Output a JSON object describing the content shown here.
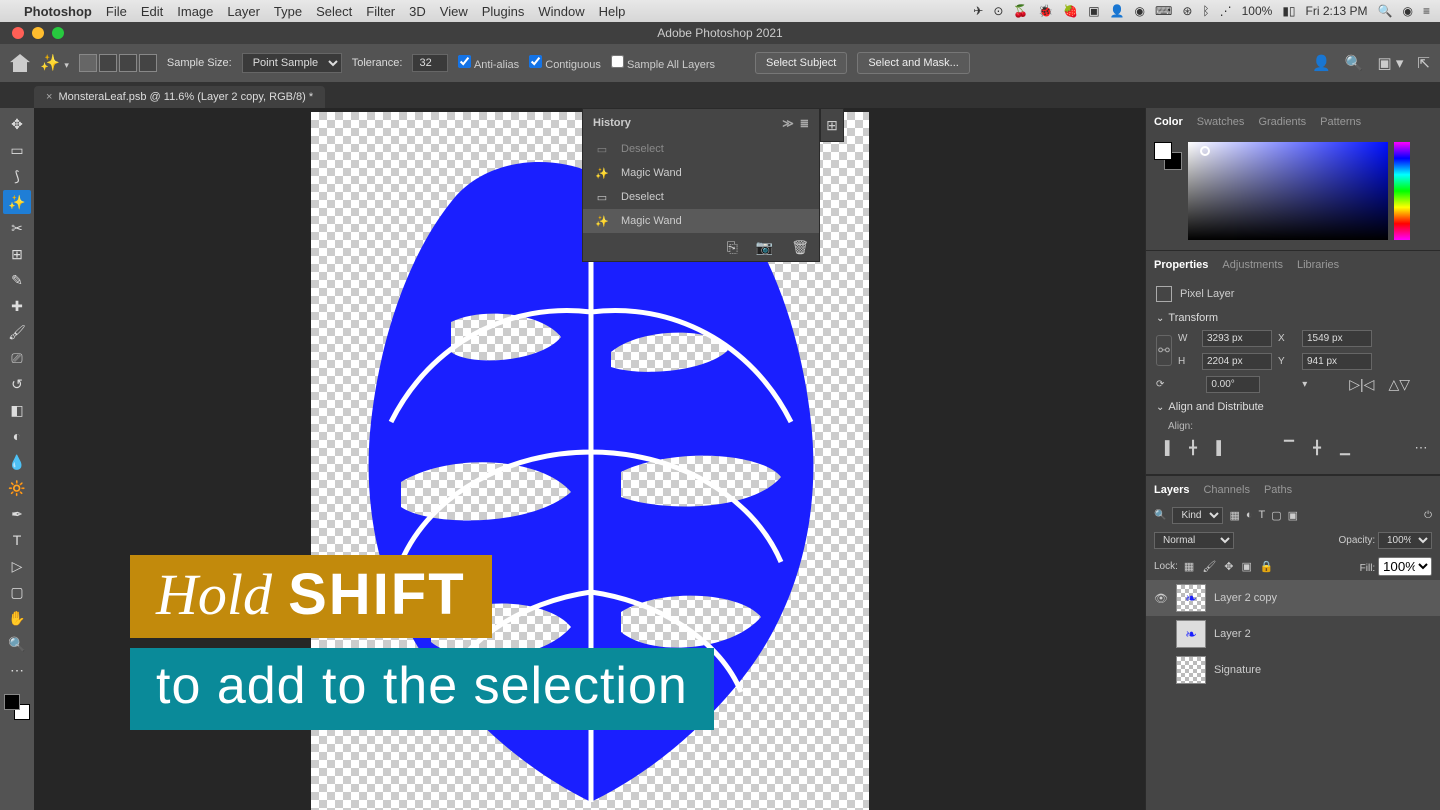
{
  "macbar": {
    "app": "Photoshop",
    "menus": [
      "File",
      "Edit",
      "Image",
      "Layer",
      "Type",
      "Select",
      "Filter",
      "3D",
      "View",
      "Plugins",
      "Window",
      "Help"
    ],
    "right_icons": [
      "✈",
      "⊙",
      "🍒",
      "🐻",
      "🍓",
      "📹",
      "👤",
      "◉",
      "⌨",
      "✱",
      "⧉",
      "✶",
      "⚡",
      "⇪",
      "100%",
      "🔋",
      "Fri 2:13 PM"
    ]
  },
  "titlebar": {
    "title": "Adobe Photoshop 2021"
  },
  "options": {
    "sample_label": "Sample Size:",
    "sample_value": "Point Sample",
    "tol_label": "Tolerance:",
    "tol_value": "32",
    "anti": "Anti-alias",
    "contig": "Contiguous",
    "sample_all": "Sample All Layers",
    "select_subject": "Select Subject",
    "select_mask": "Select and Mask..."
  },
  "doc_tab": "MonsteraLeaf.psb @ 11.6% (Layer 2 copy, RGB/8) *",
  "history": {
    "title": "History",
    "items": [
      {
        "icon": "▭",
        "label": "Deselect"
      },
      {
        "icon": "✨",
        "label": "Magic Wand"
      },
      {
        "icon": "▭",
        "label": "Deselect"
      },
      {
        "icon": "✨",
        "label": "Magic Wand"
      }
    ]
  },
  "color_tabs": [
    "Color",
    "Swatches",
    "Gradients",
    "Patterns"
  ],
  "prop_tabs": [
    "Properties",
    "Adjustments",
    "Libraries"
  ],
  "props": {
    "head": "Pixel Layer",
    "transform": "Transform",
    "W": "3293 px",
    "X": "1549 px",
    "H": "2204 px",
    "Y": "941 px",
    "rot": "0.00°",
    "align": "Align and Distribute",
    "align_sub": "Align:"
  },
  "layer_tabs": [
    "Layers",
    "Channels",
    "Paths"
  ],
  "layers": {
    "kind_label": "Kind",
    "blend": "Normal",
    "opacity_label": "Opacity:",
    "opacity": "100%",
    "lock_label": "Lock:",
    "fill_label": "Fill:",
    "fill": "100%",
    "items": [
      {
        "name": "Layer 2 copy",
        "active": true,
        "eye": true
      },
      {
        "name": "Layer 2",
        "active": false,
        "eye": false
      },
      {
        "name": "Signature",
        "active": false,
        "eye": false
      }
    ]
  },
  "caption": {
    "hold": "Hold",
    "shift": "SHIFT",
    "line2": "to add to the selection"
  }
}
